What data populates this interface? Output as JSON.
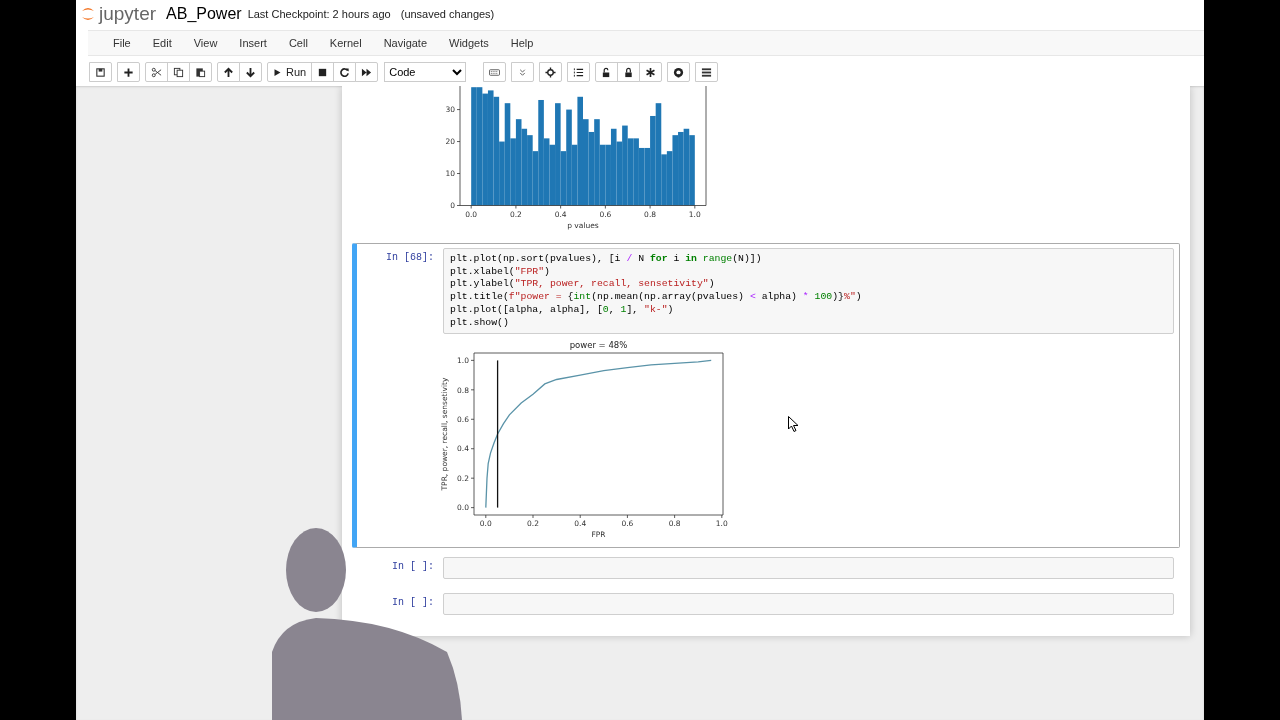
{
  "header": {
    "logo_text": "jupyter",
    "notebook_name": "AB_Power",
    "checkpoint": "Last Checkpoint: 2 hours ago",
    "save_status": "(unsaved changes)"
  },
  "menu": [
    "File",
    "Edit",
    "View",
    "Insert",
    "Cell",
    "Kernel",
    "Navigate",
    "Widgets",
    "Help"
  ],
  "toolbar": {
    "run_label": "Run",
    "cell_type": "Code"
  },
  "cells": [
    {
      "kind": "output",
      "chart_data": {
        "type": "bar",
        "xlabel": "p values",
        "xlim": [
          -0.05,
          1.05
        ],
        "ylim": [
          0,
          38
        ],
        "xticks": [
          {
            "value": 0,
            "label": "0.0"
          },
          {
            "value": 0.2,
            "label": "0.2"
          },
          {
            "value": 0.4,
            "label": "0.4"
          },
          {
            "value": 0.6,
            "label": "0.6"
          },
          {
            "value": 0.8,
            "label": "0.8"
          },
          {
            "value": 1,
            "label": "1.0"
          }
        ],
        "yticks": [
          0,
          10,
          20,
          30
        ],
        "x": [
          0.0125,
          0.0375,
          0.0625,
          0.0875,
          0.1125,
          0.1375,
          0.1625,
          0.1875,
          0.2125,
          0.2375,
          0.2625,
          0.2875,
          0.3125,
          0.3375,
          0.3625,
          0.3875,
          0.4125,
          0.4375,
          0.4625,
          0.4875,
          0.5125,
          0.5375,
          0.5625,
          0.5875,
          0.6125,
          0.6375,
          0.6625,
          0.6875,
          0.7125,
          0.7375,
          0.7625,
          0.7875,
          0.8125,
          0.8375,
          0.8625,
          0.8875,
          0.9125,
          0.9375,
          0.9625,
          0.9875
        ],
        "values": [
          37,
          37,
          35,
          36,
          34,
          20,
          32,
          21,
          27,
          24,
          22,
          17,
          33,
          21,
          19,
          32,
          17,
          30,
          19,
          34,
          27,
          23,
          27,
          19,
          19,
          24,
          20,
          25,
          21,
          21,
          18,
          18,
          28,
          32,
          16,
          17,
          22,
          23,
          24,
          22
        ]
      }
    },
    {
      "kind": "code",
      "prompt": "In [68]:",
      "selected": true,
      "code": [
        [
          {
            "kind": "p",
            "t": "plt.plot(np.sort(pvalues), [i "
          },
          {
            "kind": "op",
            "t": "/"
          },
          {
            "kind": "p",
            "t": " N "
          },
          {
            "kind": "kw",
            "t": "for"
          },
          {
            "kind": "p",
            "t": " i "
          },
          {
            "kind": "kw",
            "t": "in"
          },
          {
            "kind": "bi",
            "t": " range"
          },
          {
            "kind": "p",
            "t": "(N)])"
          }
        ],
        [
          {
            "kind": "p",
            "t": "plt.xlabel("
          },
          {
            "kind": "str",
            "t": "\"FPR\""
          },
          {
            "kind": "p",
            "t": ")"
          }
        ],
        [
          {
            "kind": "p",
            "t": "plt.ylabel("
          },
          {
            "kind": "str",
            "t": "\"TPR, power, recall, sensetivity\""
          },
          {
            "kind": "p",
            "t": ")"
          }
        ],
        [
          {
            "kind": "p",
            "t": "plt.title("
          },
          {
            "kind": "str",
            "t": "f\"power = "
          },
          {
            "kind": "p",
            "t": "{"
          },
          {
            "kind": "bi",
            "t": "int"
          },
          {
            "kind": "p",
            "t": "(np.mean(np.array(pvalues) "
          },
          {
            "kind": "op",
            "t": "<"
          },
          {
            "kind": "p",
            "t": " alpha) "
          },
          {
            "kind": "op",
            "t": "*"
          },
          {
            "kind": "num",
            "t": " 100"
          },
          {
            "kind": "p",
            "t": ")}"
          },
          {
            "kind": "str",
            "t": "%\""
          },
          {
            "kind": "p",
            "t": ")"
          }
        ],
        [
          {
            "kind": "p",
            "t": "plt.plot([alpha, alpha], ["
          },
          {
            "kind": "num",
            "t": "0"
          },
          {
            "kind": "p",
            "t": ", "
          },
          {
            "kind": "num",
            "t": "1"
          },
          {
            "kind": "p",
            "t": "], "
          },
          {
            "kind": "str",
            "t": "\"k-\""
          },
          {
            "kind": "p",
            "t": ")"
          }
        ],
        [
          {
            "kind": "p",
            "t": "plt.show()"
          }
        ]
      ],
      "chart_data": {
        "type": "line",
        "title": "power = 48%",
        "xlabel": "FPR",
        "ylabel": "TPR, power, recall, sensetivity",
        "xlim": [
          -0.05,
          1.005
        ],
        "ylim": [
          -0.05,
          1.05
        ],
        "xticks": [
          {
            "value": 0,
            "label": "0.0"
          },
          {
            "value": 0.2,
            "label": "0.2"
          },
          {
            "value": 0.4,
            "label": "0.4"
          },
          {
            "value": 0.6,
            "label": "0.6"
          },
          {
            "value": 0.8,
            "label": "0.8"
          },
          {
            "value": 1,
            "label": "1.0"
          }
        ],
        "yticks": [
          {
            "value": 0,
            "label": "0.0"
          },
          {
            "value": 0.2,
            "label": "0.2"
          },
          {
            "value": 0.4,
            "label": "0.4"
          },
          {
            "value": 0.6,
            "label": "0.6"
          },
          {
            "value": 0.8,
            "label": "0.8"
          },
          {
            "value": 1,
            "label": "1.0"
          }
        ],
        "series": [
          {
            "color": "#5a93a8",
            "x": [
              0,
              0.005,
              0.01,
              0.02,
              0.035,
              0.05,
              0.075,
              0.1,
              0.15,
              0.2,
              0.25,
              0.3,
              0.4,
              0.5,
              0.6,
              0.7,
              0.8,
              0.9,
              0.955
            ],
            "values": [
              0,
              0.2,
              0.3,
              0.37,
              0.44,
              0.5,
              0.57,
              0.63,
              0.71,
              0.77,
              0.84,
              0.87,
              0.9,
              0.93,
              0.95,
              0.97,
              0.98,
              0.99,
              1.0
            ]
          },
          {
            "color": "#111111",
            "x": [
              0.05,
              0.05
            ],
            "values": [
              0,
              1
            ]
          }
        ]
      }
    },
    {
      "kind": "code",
      "prompt": "In [ ]:",
      "selected": false
    },
    {
      "kind": "code",
      "prompt": "In [ ]:",
      "selected": false
    }
  ]
}
